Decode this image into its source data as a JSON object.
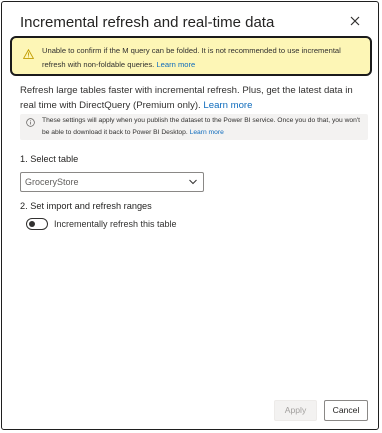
{
  "dialog": {
    "title": "Incremental refresh and real-time data",
    "close_icon": "close-icon"
  },
  "warning": {
    "icon": "warning-icon",
    "text": "Unable to confirm if the M query can be folded. It is not recommended to use incremental refresh with non-foldable queries.",
    "link": "Learn more",
    "colors": {
      "background": "#fdf6b6",
      "border": "#1b1b1b",
      "icon": "#c19c00"
    }
  },
  "intro": {
    "text": "Refresh large tables faster with incremental refresh. Plus, get the latest data in real time with DirectQuery (Premium only).",
    "link": "Learn more"
  },
  "info": {
    "icon": "info-icon",
    "text": "These settings will apply when you publish the dataset to the Power BI service. Once you do that, you won't be able to download it back to Power BI Desktop.",
    "link": "Learn more"
  },
  "step1": {
    "label": "1. Select table",
    "select_value": "GroceryStore"
  },
  "step2": {
    "label": "2. Set import and refresh ranges",
    "toggle_label": "Incrementally refresh this table",
    "toggle_on": false
  },
  "footer": {
    "apply_label": "Apply",
    "apply_disabled": true,
    "cancel_label": "Cancel"
  },
  "colors": {
    "link": "#0f6cbd",
    "text": "#323130"
  }
}
